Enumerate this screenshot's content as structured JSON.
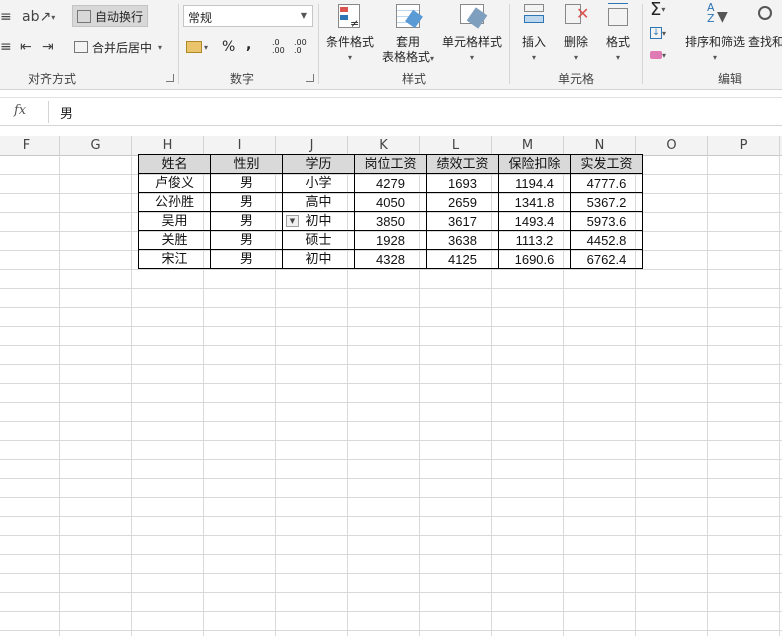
{
  "ribbon": {
    "alignment": {
      "label": "对齐方式",
      "wrap_text": "自动换行",
      "merge_center": "合并后居中"
    },
    "number": {
      "label": "数字",
      "format_value": "常规",
      "percent": "%",
      "comma": ",",
      "increase_decimal": ".0 .00",
      "decrease_decimal": ".00 .0"
    },
    "styles": {
      "label": "样式",
      "conditional_format": "条件格式",
      "table_format_line1": "套用",
      "table_format_line2": "表格格式",
      "cell_styles": "单元格样式"
    },
    "cells": {
      "label": "单元格",
      "insert": "插入",
      "delete": "删除",
      "format": "格式"
    },
    "editing": {
      "label": "编辑",
      "sort_filter": "排序和筛选",
      "find_select": "查找和"
    }
  },
  "formula_bar": {
    "fx": "fx",
    "value": "男"
  },
  "columns": [
    "F",
    "G",
    "H",
    "I",
    "J",
    "K",
    "L",
    "M",
    "N",
    "O",
    "P"
  ],
  "table": {
    "headers": [
      "姓名",
      "性别",
      "学历",
      "岗位工资",
      "绩效工资",
      "保险扣除",
      "实发工资"
    ],
    "rows": [
      [
        "卢俊义",
        "男",
        "小学",
        "4279",
        "1693",
        "1194.4",
        "4777.6"
      ],
      [
        "公孙胜",
        "男",
        "高中",
        "4050",
        "2659",
        "1341.8",
        "5367.2"
      ],
      [
        "吴用",
        "男",
        "初中",
        "3850",
        "3617",
        "1493.4",
        "5973.6"
      ],
      [
        "关胜",
        "男",
        "硕士",
        "1928",
        "3638",
        "1113.2",
        "4452.8"
      ],
      [
        "宋江",
        "男",
        "初中",
        "4328",
        "4125",
        "1690.6",
        "6762.4"
      ]
    ]
  },
  "colors": {
    "ribbon_bg": "#f3f3f3",
    "header_fill": "#d9d9d9",
    "accent_red": "#d9534f",
    "accent_blue": "#2e75b6"
  }
}
